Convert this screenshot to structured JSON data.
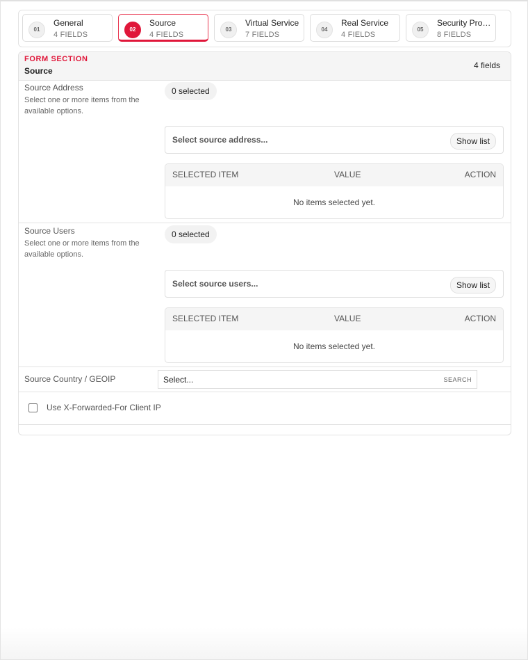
{
  "steps": [
    {
      "num": "01",
      "title": "General",
      "sub": "4 FIELDS"
    },
    {
      "num": "02",
      "title": "Source",
      "sub": "4 FIELDS"
    },
    {
      "num": "03",
      "title": "Virtual Service",
      "sub": "7 FIELDS"
    },
    {
      "num": "04",
      "title": "Real Service",
      "sub": "4 FIELDS"
    },
    {
      "num": "05",
      "title": "Security Pro…",
      "sub": "8 FIELDS"
    }
  ],
  "active_step": 1,
  "accent_color": "#e0173a",
  "section": {
    "kicker": "FORM SECTION",
    "title": "Source",
    "count": "4 fields"
  },
  "fields": {
    "source_address": {
      "label": "Source Address",
      "help": "Select one or more items from the available options.",
      "selected": "0 selected",
      "placeholder": "Select source address...",
      "show_list": "Show list",
      "columns": [
        "SELECTED ITEM",
        "VALUE",
        "ACTION"
      ],
      "empty": "No items selected yet."
    },
    "source_users": {
      "label": "Source Users",
      "help": "Select one or more items from the available options.",
      "selected": "0 selected",
      "placeholder": "Select source users...",
      "show_list": "Show list",
      "columns": [
        "SELECTED ITEM",
        "VALUE",
        "ACTION"
      ],
      "empty": "No items selected yet."
    },
    "geoip": {
      "label": "Source Country / GEOIP",
      "value": "Select...",
      "search": "SEARCH"
    },
    "xff": {
      "label": "Use X-Forwarded-For Client IP",
      "checked": false
    }
  }
}
